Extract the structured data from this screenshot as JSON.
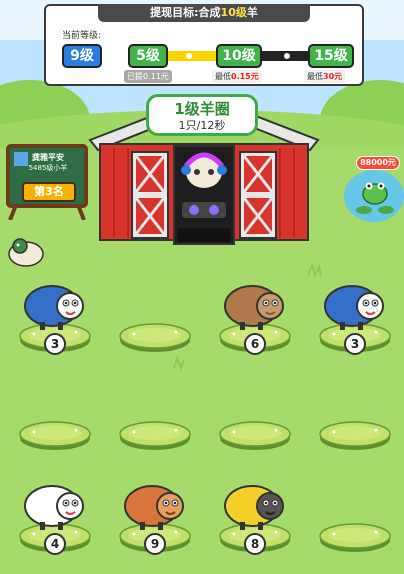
{
  "panel": {
    "header_prefix": "提现目标:合成",
    "header_level": "10级",
    "header_suffix": "羊",
    "current_label": "当前等级:",
    "current_level": "9级",
    "milestones": [
      {
        "level": "5级",
        "reward": "已提0.11元"
      },
      {
        "level": "10级",
        "reward_prefix": "最低",
        "reward_value": "0.15元"
      },
      {
        "level": "15级",
        "reward_prefix": "最低",
        "reward_value": "30元"
      }
    ],
    "progress": 0.35
  },
  "barn": {
    "title": "1级羊圈",
    "rate": "1只/12秒"
  },
  "leaderboard": {
    "name": "龚雅平安",
    "subtitle": "5485级小羊",
    "rank": "第3名"
  },
  "pond": {
    "reward": "88000元"
  },
  "plots": [
    {
      "row": 0,
      "col": 0,
      "level": "3",
      "sheep": "blue"
    },
    {
      "row": 0,
      "col": 1,
      "level": "",
      "sheep": "none"
    },
    {
      "row": 0,
      "col": 2,
      "level": "6",
      "sheep": "brown-bunny"
    },
    {
      "row": 0,
      "col": 3,
      "level": "3",
      "sheep": "blue"
    },
    {
      "row": 1,
      "col": 0,
      "level": "",
      "sheep": "none"
    },
    {
      "row": 1,
      "col": 1,
      "level": "",
      "sheep": "none"
    },
    {
      "row": 1,
      "col": 2,
      "level": "",
      "sheep": "none"
    },
    {
      "row": 1,
      "col": 3,
      "level": "",
      "sheep": "none"
    },
    {
      "row": 2,
      "col": 0,
      "level": "4",
      "sheep": "white-red"
    },
    {
      "row": 2,
      "col": 1,
      "level": "9",
      "sheep": "orange-bear"
    },
    {
      "row": 2,
      "col": 2,
      "level": "8",
      "sheep": "yellow-tiger"
    },
    {
      "row": 2,
      "col": 3,
      "level": "",
      "sheep": "none"
    }
  ],
  "colors": {
    "grass": "#a6da6b",
    "sky": "#bfe4ff",
    "barn_red": "#d9332d",
    "accent_green": "#3fb54a"
  }
}
